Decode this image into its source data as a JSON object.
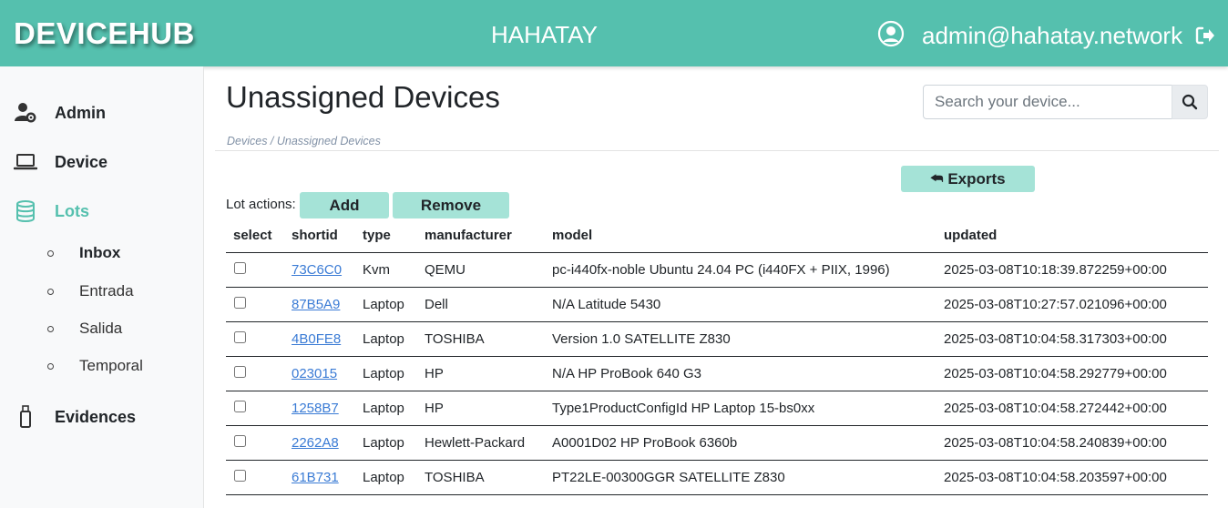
{
  "header": {
    "brand": "DEVICEHUB",
    "organization": "HAHATAY",
    "user_email": "admin@hahatay.network",
    "user_icon": "user-circle-icon",
    "logout_icon": "logout-icon"
  },
  "sidebar": {
    "items": [
      {
        "label": "Admin",
        "icon": "user-gear-icon"
      },
      {
        "label": "Device",
        "icon": "laptop-icon"
      },
      {
        "label": "Lots",
        "icon": "database-icon"
      },
      {
        "label": "Evidences",
        "icon": "usb-drive-icon"
      }
    ],
    "lots": [
      {
        "label": "Inbox"
      },
      {
        "label": "Entrada"
      },
      {
        "label": "Salida"
      },
      {
        "label": "Temporal"
      }
    ]
  },
  "main": {
    "title": "Unassigned Devices",
    "breadcrumb": "Devices / Unassigned Devices",
    "search_placeholder": "Search your device...",
    "exports_label": "Exports",
    "lot_actions_label": "Lot actions:",
    "add_label": "Add",
    "remove_label": "Remove",
    "columns": [
      "select",
      "shortid",
      "type",
      "manufacturer",
      "model",
      "updated"
    ],
    "rows": [
      {
        "shortid": "73C6C0",
        "type": "Kvm",
        "manufacturer": "QEMU",
        "model": "pc-i440fx-noble Ubuntu 24.04 PC (i440FX + PIIX, 1996)",
        "updated": "2025-03-08T10:18:39.872259+00:00"
      },
      {
        "shortid": "87B5A9",
        "type": "Laptop",
        "manufacturer": "Dell",
        "model": "N/A Latitude 5430",
        "updated": "2025-03-08T10:27:57.021096+00:00"
      },
      {
        "shortid": "4B0FE8",
        "type": "Laptop",
        "manufacturer": "TOSHIBA",
        "model": "Version 1.0 SATELLITE Z830",
        "updated": "2025-03-08T10:04:58.317303+00:00"
      },
      {
        "shortid": "023015",
        "type": "Laptop",
        "manufacturer": "HP",
        "model": "N/A HP ProBook 640 G3",
        "updated": "2025-03-08T10:04:58.292779+00:00"
      },
      {
        "shortid": "1258B7",
        "type": "Laptop",
        "manufacturer": "HP",
        "model": "Type1ProductConfigId HP Laptop 15-bs0xx",
        "updated": "2025-03-08T10:04:58.272442+00:00"
      },
      {
        "shortid": "2262A8",
        "type": "Laptop",
        "manufacturer": "Hewlett-Packard",
        "model": "A0001D02 HP ProBook 6360b",
        "updated": "2025-03-08T10:04:58.240839+00:00"
      },
      {
        "shortid": "61B731",
        "type": "Laptop",
        "manufacturer": "TOSHIBA",
        "model": "PT22LE-00300GGR SATELLITE Z830",
        "updated": "2025-03-08T10:04:58.203597+00:00"
      }
    ]
  },
  "colors": {
    "accent": "#55c0ae",
    "button": "#a5e3d7",
    "link": "#3a7bd5"
  }
}
